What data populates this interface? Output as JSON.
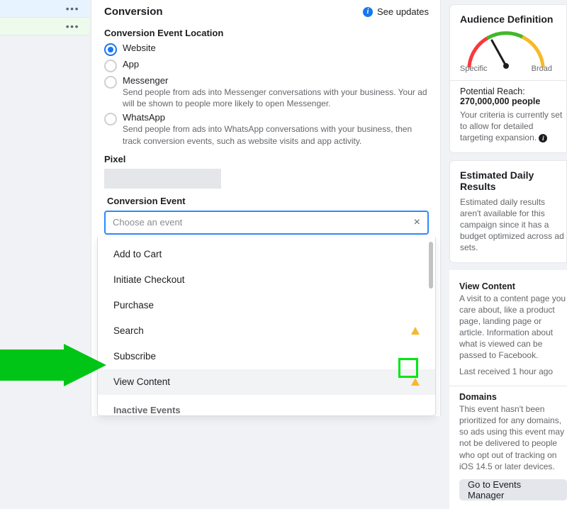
{
  "header": {
    "title": "Conversion",
    "see_updates": "See updates"
  },
  "conversion_location": {
    "heading": "Conversion Event Location",
    "options": {
      "website": {
        "label": "Website"
      },
      "app": {
        "label": "App"
      },
      "messenger": {
        "label": "Messenger",
        "help": "Send people from ads into Messenger conversations with your business. Your ad will be shown to people more likely to open Messenger."
      },
      "whatsapp": {
        "label": "WhatsApp",
        "help": "Send people from ads into WhatsApp conversations with your business, then track conversion events, such as website visits and app activity."
      }
    }
  },
  "pixel": {
    "heading": "Pixel"
  },
  "conversion_event": {
    "heading": "Conversion Event",
    "placeholder": "Choose an event",
    "options": [
      {
        "label": "Add to Cart",
        "warn": false
      },
      {
        "label": "Initiate Checkout",
        "warn": false
      },
      {
        "label": "Purchase",
        "warn": false
      },
      {
        "label": "Search",
        "warn": true
      },
      {
        "label": "Subscribe",
        "warn": false
      },
      {
        "label": "View Content",
        "warn": true
      }
    ],
    "inactive_heading": "Inactive Events"
  },
  "audience_definition": {
    "heading": "Audience Definition",
    "specific": "Specific",
    "broad": "Broad",
    "reach_label": "Potential Reach:",
    "reach_value": "270,000,000 people",
    "criteria_text": "Your criteria is currently set to allow for detailed targeting expansion."
  },
  "estimated_daily": {
    "heading": "Estimated Daily Results",
    "body": "Estimated daily results aren't available for this campaign since it has a budget optimized across ad sets."
  },
  "event_details": {
    "title": "View Content",
    "body": "A visit to a content page you care about, like a product page, landing page or article. Information about what is viewed can be passed to Facebook.",
    "last_received": "Last received 1 hour ago",
    "domains_heading": "Domains",
    "domains_body": "This event hasn't been prioritized for any domains, so ads using this event may not be delivered to people who opt out of tracking on iOS 14.5 or later devices.",
    "button": "Go to Events Manager"
  }
}
